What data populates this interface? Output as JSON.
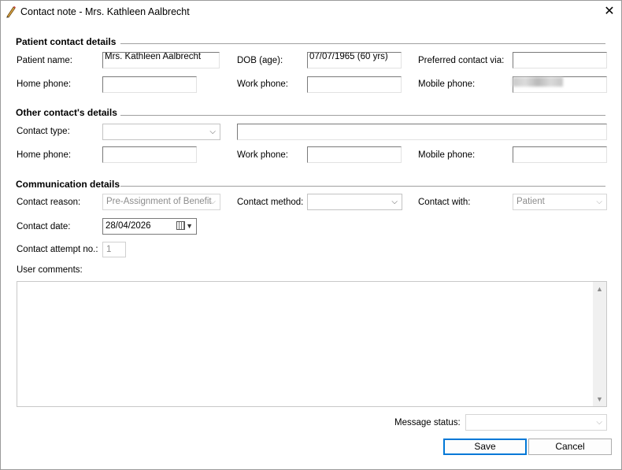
{
  "window": {
    "title": "Contact note - Mrs. Kathleen Aalbrecht",
    "close_glyph": "✕"
  },
  "patient_section": {
    "heading": "Patient contact details",
    "patient_name_label": "Patient name:",
    "patient_name_value": "Mrs. Kathleen Aalbrecht",
    "dob_label": "DOB (age):",
    "dob_value": "07/07/1965 (60 yrs)",
    "preferred_label": "Preferred contact via:",
    "preferred_value": "",
    "home_phone_label": "Home phone:",
    "home_phone_value": "",
    "work_phone_label": "Work phone:",
    "work_phone_value": "",
    "mobile_phone_label": "Mobile phone:"
  },
  "other_section": {
    "heading": "Other contact's details",
    "contact_type_label": "Contact type:",
    "contact_type_value": "",
    "contact_name_value": "",
    "home_phone_label": "Home phone:",
    "work_phone_label": "Work phone:",
    "mobile_phone_label": "Mobile phone:"
  },
  "communication_section": {
    "heading": "Communication details",
    "reason_label": "Contact reason:",
    "reason_value": "Pre-Assignment of Benefit",
    "method_label": "Contact method:",
    "method_value": "",
    "with_label": "Contact with:",
    "with_value": "Patient",
    "date_label": "Contact date:",
    "date_value": "28/04/2026",
    "attempt_label": "Contact attempt no.:",
    "attempt_value": "1",
    "comments_label": "User comments:",
    "comments_value": ""
  },
  "footer": {
    "message_status_label": "Message status:",
    "message_status_value": "",
    "save_label": "Save",
    "cancel_label": "Cancel"
  },
  "icons": {
    "title": "pencil-icon",
    "dropdown": "chevron-down-icon",
    "calendar": "calendar-icon"
  },
  "colors": {
    "accent": "#0078d7",
    "disabled_text": "#8c8c8c"
  }
}
